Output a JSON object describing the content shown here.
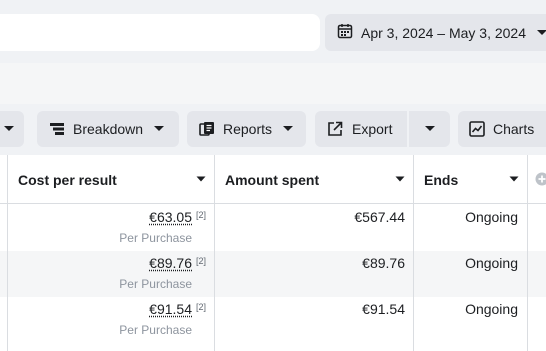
{
  "date_range": {
    "label": "Apr 3, 2024 – May 3, 2024"
  },
  "toolbar": {
    "breakdown_label": "Breakdown",
    "reports_label": "Reports",
    "export_label": "Export",
    "charts_label": "Charts"
  },
  "table": {
    "columns": [
      "Cost per result",
      "Amount spent",
      "Ends"
    ],
    "rows": [
      {
        "cost": "€63.05",
        "footnote": "[2]",
        "result_type": "Per Purchase",
        "spent": "€567.44",
        "ends": "Ongoing"
      },
      {
        "cost": "€89.76",
        "footnote": "[2]",
        "result_type": "Per Purchase",
        "spent": "€89.76",
        "ends": "Ongoing"
      },
      {
        "cost": "€91.54",
        "footnote": "[2]",
        "result_type": "Per Purchase",
        "spent": "€91.54",
        "ends": "Ongoing"
      }
    ]
  }
}
